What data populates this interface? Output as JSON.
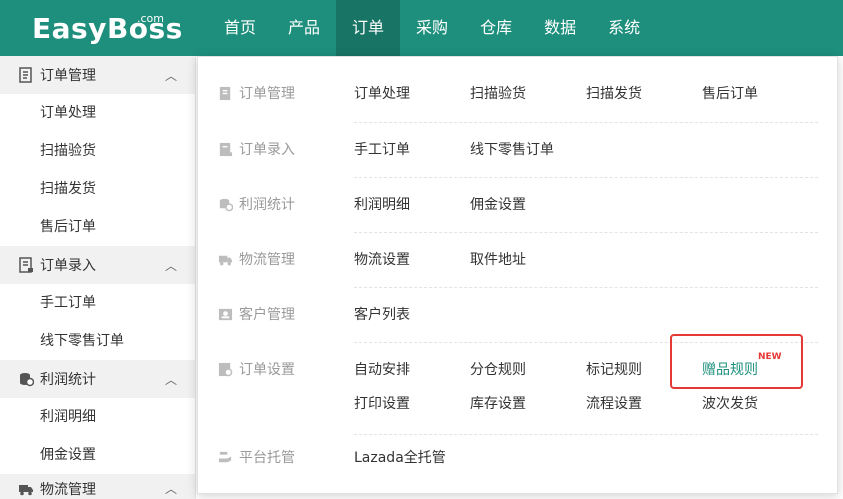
{
  "logo": {
    "text": "EasyBoss",
    "suffix": ".com"
  },
  "nav": [
    "首页",
    "产品",
    "订单",
    "采购",
    "仓库",
    "数据",
    "系统"
  ],
  "sidebar": {
    "groups": [
      {
        "label": "订单管理",
        "items": [
          "订单处理",
          "扫描验货",
          "扫描发货",
          "售后订单"
        ]
      },
      {
        "label": "订单录入",
        "items": [
          "手工订单",
          "线下零售订单"
        ]
      },
      {
        "label": "利润统计",
        "items": [
          "利润明细",
          "佣金设置"
        ]
      },
      {
        "label": "物流管理",
        "items": []
      }
    ]
  },
  "dropdown": {
    "rows": [
      {
        "category": "订单管理",
        "links": [
          "订单处理",
          "扫描验货",
          "扫描发货",
          "售后订单"
        ]
      },
      {
        "category": "订单录入",
        "links": [
          "手工订单",
          "线下零售订单"
        ]
      },
      {
        "category": "利润统计",
        "links": [
          "利润明细",
          "佣金设置"
        ]
      },
      {
        "category": "物流管理",
        "links": [
          "物流设置",
          "取件地址"
        ]
      },
      {
        "category": "客户管理",
        "links": [
          "客户列表"
        ]
      },
      {
        "category": "订单设置",
        "links": [
          "自动安排",
          "分仓规则",
          "标记规则",
          "赠品规则",
          "打印设置",
          "库存设置",
          "流程设置",
          "波次发货"
        ]
      },
      {
        "category": "平台托管",
        "links": [
          "Lazada全托管"
        ]
      }
    ],
    "new_badge": "NEW"
  },
  "colors": {
    "brand": "#1e8f7c",
    "nav_active": "#187565",
    "highlight_box": "#e53935"
  }
}
